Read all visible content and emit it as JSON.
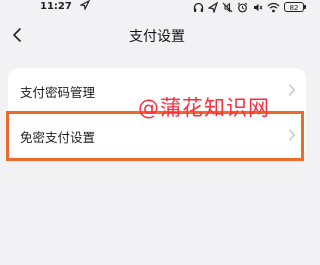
{
  "status_bar": {
    "time": "11:27",
    "battery": "82",
    "icons": [
      "location-arrow-icon",
      "headset-icon",
      "navigation-icon",
      "mute-icon",
      "alarm-icon",
      "volume-off-icon",
      "wifi-icon",
      "battery-icon"
    ]
  },
  "header": {
    "title": "支付设置",
    "back_icon": "chevron-left-icon"
  },
  "settings": {
    "items": [
      {
        "label": "支付密码管理"
      },
      {
        "label": "免密支付设置"
      }
    ]
  },
  "overlay": {
    "watermark": "@蒲花知识网",
    "highlight_color": "#ee6a2c",
    "watermark_color": "#ff2d3c"
  }
}
